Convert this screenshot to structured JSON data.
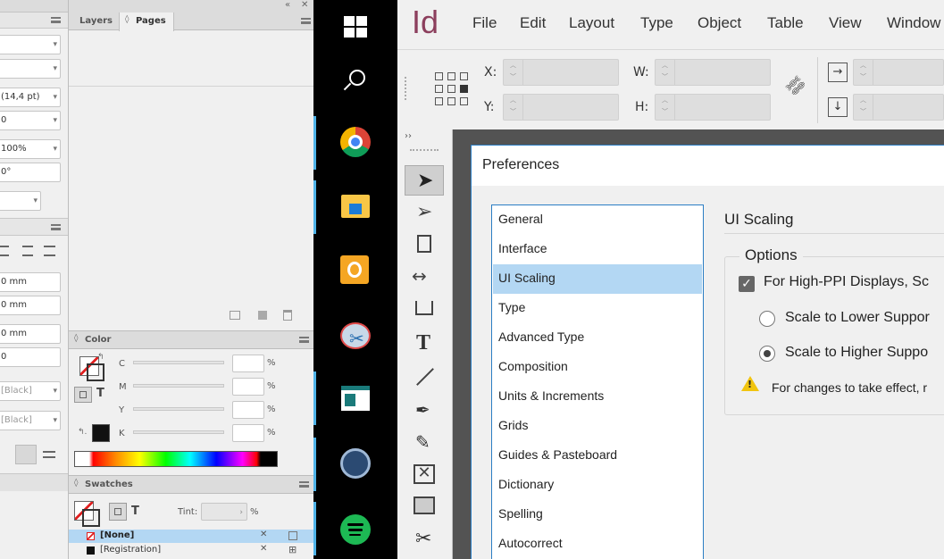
{
  "left_panel": {
    "fields": [
      "",
      "",
      "(14,4 pt)",
      "0",
      "100%",
      "0°",
      ""
    ],
    "para_fields": [
      "0 mm",
      "0 mm",
      "0 mm",
      "0"
    ],
    "swatch_fields": [
      "[Black]",
      "[Black]"
    ]
  },
  "pages_panel": {
    "tabs": [
      {
        "label": "Layers"
      },
      {
        "label": "Pages"
      }
    ]
  },
  "color_panel": {
    "title": "Color",
    "channels": [
      {
        "label": "C",
        "unit": "%"
      },
      {
        "label": "M",
        "unit": "%"
      },
      {
        "label": "Y",
        "unit": "%"
      },
      {
        "label": "K",
        "unit": "%"
      }
    ],
    "fill_stroke_glyph": "T"
  },
  "swatches_panel": {
    "title": "Swatches",
    "tint_label": "Tint:",
    "tint_unit": "%",
    "items": [
      {
        "name": "[None]",
        "color": "#e02020",
        "selected": true
      },
      {
        "name": "[Registration]",
        "color": "#111111",
        "selected": false
      }
    ]
  },
  "taskbar": {
    "items": [
      "windows-start",
      "search",
      "chrome",
      "file-explorer",
      "outlook",
      "snipping-tool",
      "app-window",
      "teamspeak",
      "spotify"
    ]
  },
  "indesign": {
    "logo": "Id",
    "menu": [
      "File",
      "Edit",
      "Layout",
      "Type",
      "Object",
      "Table",
      "View",
      "Window"
    ],
    "control": {
      "x_label": "X:",
      "y_label": "Y:",
      "w_label": "W:",
      "h_label": "H:"
    }
  },
  "preferences": {
    "title": "Preferences",
    "categories": [
      "General",
      "Interface",
      "UI Scaling",
      "Type",
      "Advanced Type",
      "Composition",
      "Units & Increments",
      "Grids",
      "Guides & Pasteboard",
      "Dictionary",
      "Spelling",
      "Autocorrect"
    ],
    "selected_index": 2,
    "section_title": "UI Scaling",
    "group_title": "Options",
    "checkbox_label": "For High-PPI Displays, Sc",
    "radio_lower": "Scale to Lower Suppor",
    "radio_higher": "Scale to Higher Suppo",
    "warning": "For changes to take effect, r"
  },
  "colors": {
    "accent": "#b3d7f3",
    "indesign": "#49021f"
  }
}
